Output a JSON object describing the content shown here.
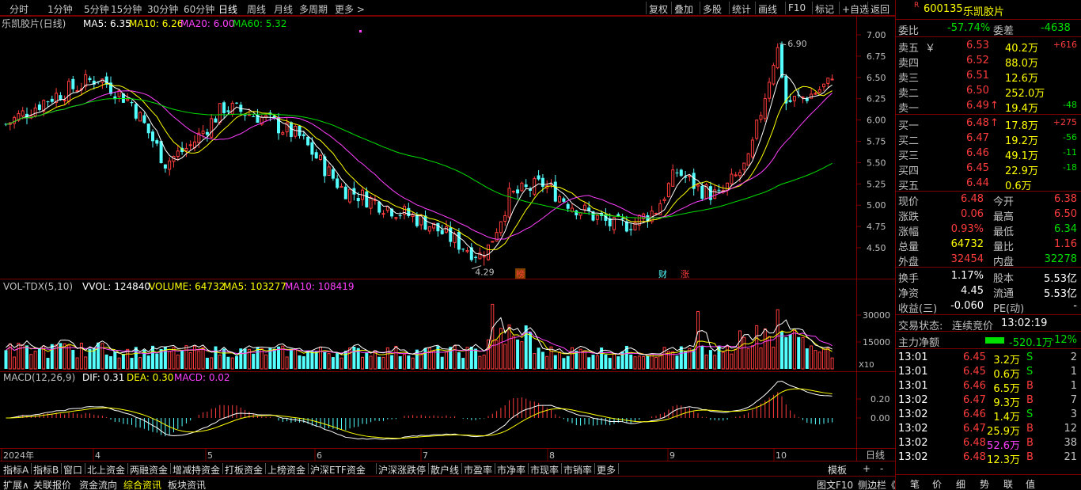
{
  "topbar": {
    "tabs": [
      "分时",
      "1分钟",
      "5分钟",
      "15分钟",
      "30分钟",
      "60分钟",
      "日线",
      "周线",
      "月线",
      "多周期",
      "更多 >"
    ],
    "active": "日线",
    "tools": [
      "复权",
      "叠加",
      "多股",
      "统计",
      "画线",
      "F10",
      "标记",
      "+自选",
      "返回"
    ]
  },
  "main": {
    "stock": "乐凯胶片(日线)",
    "ma": [
      {
        "label": "MA5: 6.35",
        "color": "#ffffff"
      },
      {
        "label": "MA10: 6.26",
        "color": "#ffff00"
      },
      {
        "label": "MA20: 6.00",
        "color": "#ff40ff"
      },
      {
        "label": "MA60: 5.32",
        "color": "#00e000"
      }
    ],
    "yaxis": [
      "7.00",
      "6.75",
      "6.50",
      "6.25",
      "6.00",
      "5.75",
      "5.50",
      "5.25",
      "5.00",
      "4.75",
      "4.50"
    ],
    "high_label": "6.90",
    "low_label": "4.29",
    "markers": [
      "榜",
      "财",
      "涨"
    ]
  },
  "volume": {
    "title": "VOL-TDX(5,10)",
    "vvol": "VVOL: 124840",
    "volume": "VOLUME: 64732",
    "ma5": "MA5: 103277",
    "ma10": "MA10: 108419",
    "yaxis": [
      "30000",
      "15000"
    ],
    "unit": "X10"
  },
  "macd": {
    "title": "MACD(12,26,9)",
    "dif": "DIF: 0.31",
    "dea": "DEA: 0.30",
    "macd": "MACD: 0.02",
    "yaxis": [
      "0.20",
      "0.00"
    ]
  },
  "dates": [
    "2024年",
    "4",
    "5",
    "6",
    "7",
    "8",
    "9",
    "10"
  ],
  "period_label": "日线",
  "bottom1": [
    "指标A",
    "指标B",
    "窗口",
    "北上资金",
    "两融资金",
    "增减持资金",
    "打板资金",
    "上榜资金",
    "沪深ETF资金",
    "沪深涨跌停",
    "散户线",
    "市盈率",
    "市净率",
    "市现率",
    "市销率",
    "更多"
  ],
  "bottom1_right": [
    "模板",
    "+",
    "-"
  ],
  "bottom2": [
    "扩展∧",
    "关联报价",
    "资金流向",
    "综合资讯",
    "板块资讯"
  ],
  "bottom2_right": [
    "图文F10",
    "侧边栏《"
  ],
  "right": {
    "code": "600135",
    "name": "乐凯胶片",
    "r_mark": "R",
    "weibi_label": "委比",
    "weibi": "-57.74%",
    "weicha_label": "委差",
    "weicha": "-4638",
    "asks": [
      {
        "label": "卖五",
        "sym": "￥",
        "price": "6.53",
        "vol": "40.2万",
        "chg": "+616"
      },
      {
        "label": "卖四",
        "sym": "",
        "price": "6.52",
        "vol": "88.0万",
        "chg": ""
      },
      {
        "label": "卖三",
        "sym": "",
        "price": "6.51",
        "vol": "12.6万",
        "chg": ""
      },
      {
        "label": "卖二",
        "sym": "",
        "price": "6.50",
        "vol": "252.0万",
        "chg": ""
      },
      {
        "label": "卖一",
        "sym": "",
        "price": "6.49",
        "vol": "19.4万",
        "chg": "-48",
        "arrow": "↑"
      }
    ],
    "bids": [
      {
        "label": "买一",
        "price": "6.48",
        "vol": "17.8万",
        "chg": "+275",
        "arrow": "↑"
      },
      {
        "label": "买二",
        "price": "6.47",
        "vol": "19.2万",
        "chg": "-56"
      },
      {
        "label": "买三",
        "price": "6.46",
        "vol": "49.1万",
        "chg": "-11"
      },
      {
        "label": "买四",
        "price": "6.45",
        "vol": "22.9万",
        "chg": "-18"
      },
      {
        "label": "买五",
        "price": "6.44",
        "vol": "0.6万",
        "chg": ""
      }
    ],
    "stats": [
      {
        "l1": "现价",
        "v1": "6.48",
        "c1": "red",
        "l2": "今开",
        "v2": "6.38",
        "c2": "red"
      },
      {
        "l1": "涨跌",
        "v1": "0.06",
        "c1": "red",
        "l2": "最高",
        "v2": "6.50",
        "c2": "red"
      },
      {
        "l1": "涨幅",
        "v1": "0.93%",
        "c1": "red",
        "l2": "最低",
        "v2": "6.34",
        "c2": "green"
      },
      {
        "l1": "总量",
        "v1": "64732",
        "c1": "yel",
        "l2": "量比",
        "v2": "1.16",
        "c2": "red"
      },
      {
        "l1": "外盘",
        "v1": "32454",
        "c1": "red",
        "l2": "内盘",
        "v2": "32278",
        "c2": "green"
      }
    ],
    "stats2": [
      {
        "l1": "换手",
        "v1": "1.17%",
        "l2": "股本",
        "v2": "5.53亿"
      },
      {
        "l1": "净资",
        "v1": "4.45",
        "l2": "流通",
        "v2": "5.53亿"
      },
      {
        "l1": "收益(三)",
        "v1": "-0.060",
        "l2": "PE(动)",
        "v2": "-"
      }
    ],
    "status_label": "交易状态:",
    "status": "连续竞价",
    "time": "13:02:19",
    "flow_label": "主力净额",
    "flow": "-520.1万",
    "flow_pct": "-12%",
    "ticks": [
      {
        "t": "13:01",
        "p": "6.45",
        "v": "3.2万",
        "s": "S",
        "n": "2"
      },
      {
        "t": "13:01",
        "p": "6.45",
        "v": "0.6万",
        "s": "S",
        "n": "1"
      },
      {
        "t": "13:01",
        "p": "6.46",
        "v": "6.5万",
        "s": "B",
        "n": "1"
      },
      {
        "t": "13:02",
        "p": "6.47",
        "v": "9.3万",
        "s": "B",
        "n": "7"
      },
      {
        "t": "13:02",
        "p": "6.46",
        "v": "1.4万",
        "s": "S",
        "n": "3"
      },
      {
        "t": "13:02",
        "p": "6.47",
        "v": "25.9万",
        "s": "B",
        "n": "12"
      },
      {
        "t": "13:02",
        "p": "6.48",
        "v": "52.6万",
        "s": "B",
        "n": "38"
      },
      {
        "t": "13:02",
        "p": "6.48",
        "v": "12.3万",
        "s": "B",
        "n": "21"
      }
    ],
    "bottom_tabs": [
      "笔",
      "价",
      "细",
      "势",
      "联",
      "值"
    ]
  },
  "colors": {
    "up": "#ff3c3c",
    "down": "#54ffff",
    "frame": "#7a0000"
  }
}
